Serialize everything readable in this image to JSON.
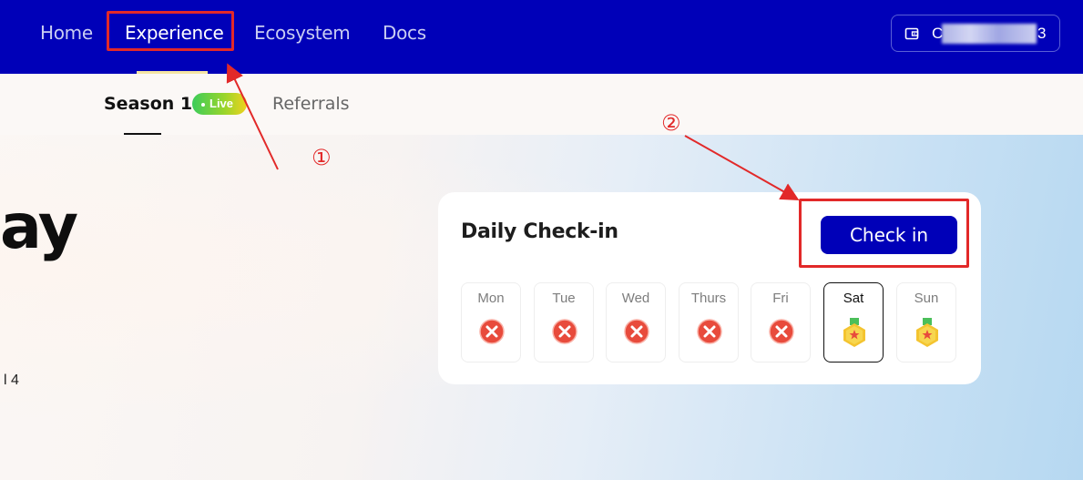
{
  "nav": {
    "items": [
      {
        "label": "Home"
      },
      {
        "label": "Experience",
        "active": true
      },
      {
        "label": "Ecosystem"
      },
      {
        "label": "Docs"
      }
    ],
    "wallet": {
      "address_prefix": "C",
      "address_suffix": "3",
      "icon": "wallet-icon"
    }
  },
  "subnav": {
    "season_label": "Season 1",
    "live_badge": "Live",
    "referrals_label": "Referrals"
  },
  "hero": {
    "word_fragment": "ay",
    "small_fragment": "l 4"
  },
  "checkin_card": {
    "title": "Daily Check-in",
    "button_label": "Check in",
    "days": [
      {
        "label": "Mon",
        "status": "missed",
        "icon": "cross-icon"
      },
      {
        "label": "Tue",
        "status": "missed",
        "icon": "cross-icon"
      },
      {
        "label": "Wed",
        "status": "missed",
        "icon": "cross-icon"
      },
      {
        "label": "Thurs",
        "status": "missed",
        "icon": "cross-icon"
      },
      {
        "label": "Fri",
        "status": "missed",
        "icon": "cross-icon"
      },
      {
        "label": "Sat",
        "status": "today",
        "icon": "medal-icon"
      },
      {
        "label": "Sun",
        "status": "upcoming",
        "icon": "medal-icon"
      }
    ]
  },
  "annotations": {
    "marker_1": "①",
    "marker_2": "②"
  },
  "colors": {
    "brand": "#0000b8",
    "annotation": "#e22929",
    "missed": "#e84b3c",
    "medal": "#f4c430"
  }
}
